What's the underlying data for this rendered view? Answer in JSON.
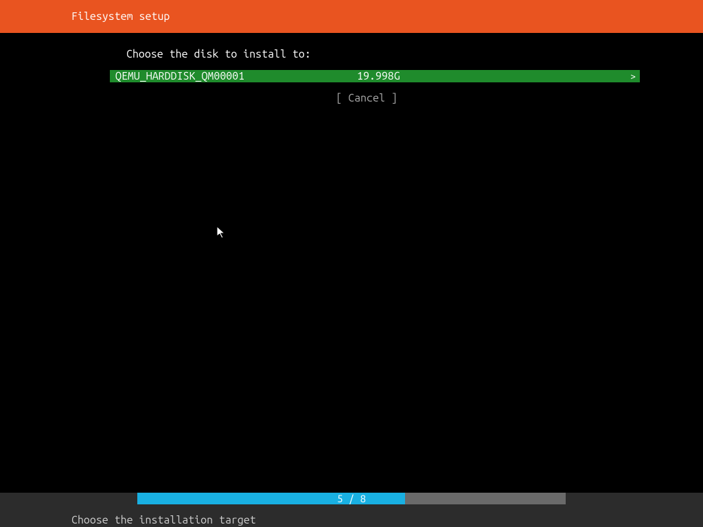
{
  "colors": {
    "header_bg": "#e95420",
    "selected_bg": "#1f8b2c",
    "progress_fill": "#19b0e2",
    "progress_track": "#6a6a6a",
    "footer_bg": "#2c2c2c"
  },
  "header": {
    "title": "Filesystem setup"
  },
  "main": {
    "prompt": "Choose the disk to install to:",
    "disks": [
      {
        "name": "QEMU_HARDDISK_QM00001",
        "size": "19.998G",
        "arrow": ">"
      }
    ],
    "cancel_label": "[ Cancel    ]"
  },
  "progress": {
    "current": 5,
    "total": 8,
    "label": "5 / 8",
    "percent": 62.5
  },
  "footer": {
    "status": "Choose the installation target"
  }
}
